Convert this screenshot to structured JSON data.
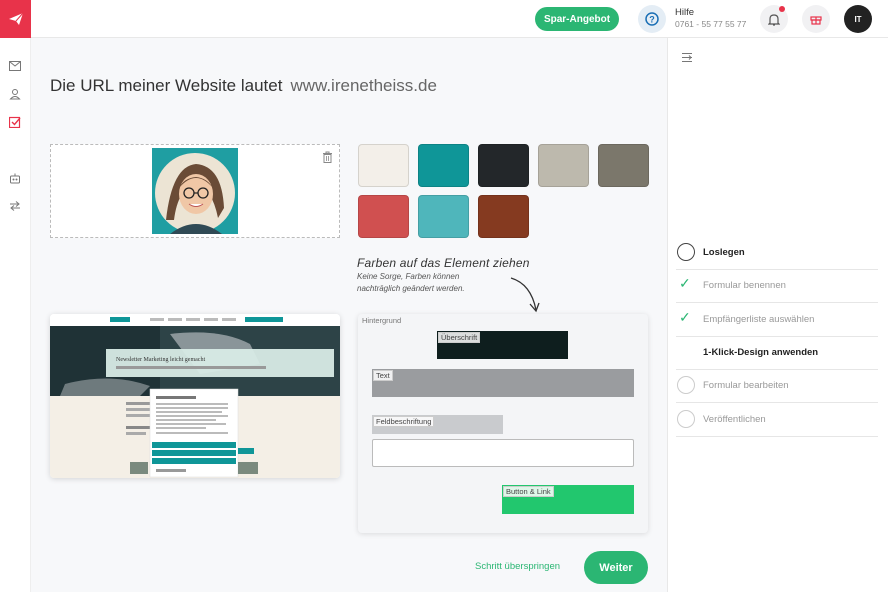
{
  "topbar": {
    "spar_label": "Spar-Angebot",
    "help_label": "Hilfe",
    "help_phone": "0761 - 55 77 55 77",
    "avatar_initials": "IT"
  },
  "main": {
    "title": "Die URL meiner Website lautet",
    "url": "www.irenetheiss.de",
    "swatches": [
      "#f3efe9",
      "#0f9698",
      "#23272a",
      "#bdb9ad",
      "#7b776b",
      "#d05050",
      "#4fb6bb",
      "#853a20"
    ],
    "hint_title": "Farben auf das Element ziehen",
    "hint_sub_line1": "Keine Sorge, Farben können",
    "hint_sub_line2": "nachträglich geändert werden.",
    "form_card": {
      "background_label": "Hintergrund",
      "heading_label": "Überschrift",
      "text_label": "Text",
      "field_label": "Feldbeschriftung",
      "button_label": "Button & Link"
    },
    "preview": {
      "banner_text": "Newsletter Marketing leicht gemacht"
    },
    "skip_label": "Schritt überspringen",
    "next_label": "Weiter"
  },
  "steps": [
    {
      "label": "Loslegen",
      "state": "active"
    },
    {
      "label": "Formular benennen",
      "state": "done"
    },
    {
      "label": "Empfängerliste auswählen",
      "state": "done"
    },
    {
      "label": "1-Klick-Design anwenden",
      "state": "current"
    },
    {
      "label": "Formular bearbeiten",
      "state": "todo"
    },
    {
      "label": "Veröffentlichen",
      "state": "todo"
    }
  ]
}
